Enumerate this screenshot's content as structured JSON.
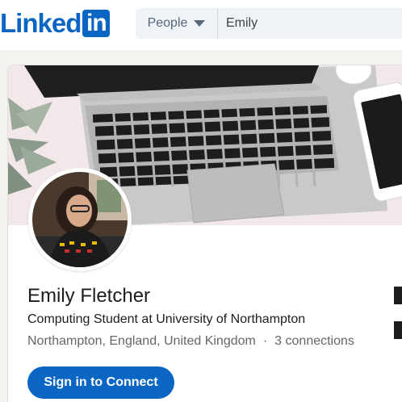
{
  "header": {
    "logo_text": "Linked",
    "logo_box": "in",
    "search_filter": "People",
    "search_value": "Emily"
  },
  "profile": {
    "name": "Emily Fletcher",
    "headline": "Computing Student at University of Northampton",
    "location": "Northampton, England, United Kingdom",
    "separator": "·",
    "connections": "3 connections",
    "cta_label": "Sign in to Connect"
  },
  "colors": {
    "brand": "#0a66c2",
    "cover_bg": "#f1e6e8"
  }
}
